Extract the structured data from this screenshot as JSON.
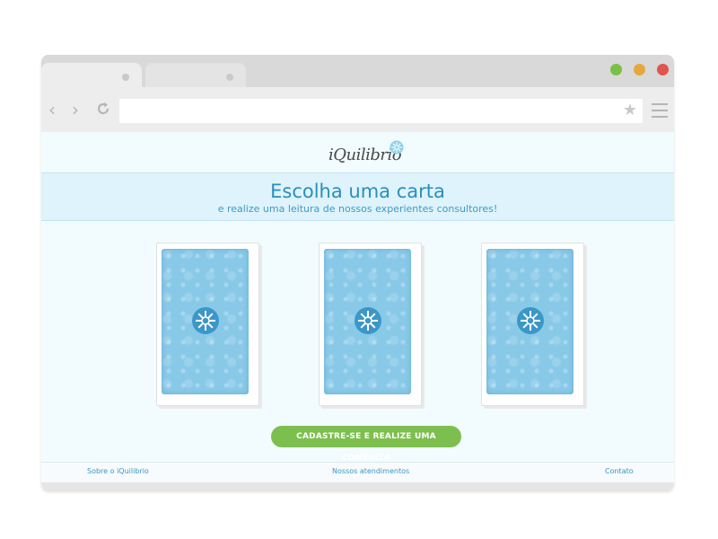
{
  "browser": {
    "tabs": [
      {
        "label": ""
      },
      {
        "label": ""
      }
    ],
    "url": "",
    "traffic_lights": {
      "green": "#7ac143",
      "yellow": "#e5a93b",
      "red": "#e0554e"
    },
    "icons": [
      "back-arrow-icon",
      "forward-arrow-icon",
      "reload-icon",
      "star-icon",
      "menu-icon"
    ]
  },
  "site": {
    "logo_text": "iQuilibrio",
    "banner": {
      "title": "Escolha uma carta",
      "subtitle": "e realize uma leitura de nossos experientes consultores!"
    },
    "cards": [
      {
        "emblem": "flower-emblem-icon"
      },
      {
        "emblem": "flower-emblem-icon"
      },
      {
        "emblem": "flower-emblem-icon"
      }
    ],
    "cta_label": "CADASTRE-SE E REALIZE UMA CONSULTA",
    "footer": {
      "about": "Sobre o iQuilibrio",
      "services": "Nossos atendimentos",
      "contact": "Contato"
    },
    "colors": {
      "accent": "#2a8ebc",
      "cta": "#7dbf4f",
      "card": "#89c9e8",
      "banner_bg": "#def3fb"
    }
  }
}
